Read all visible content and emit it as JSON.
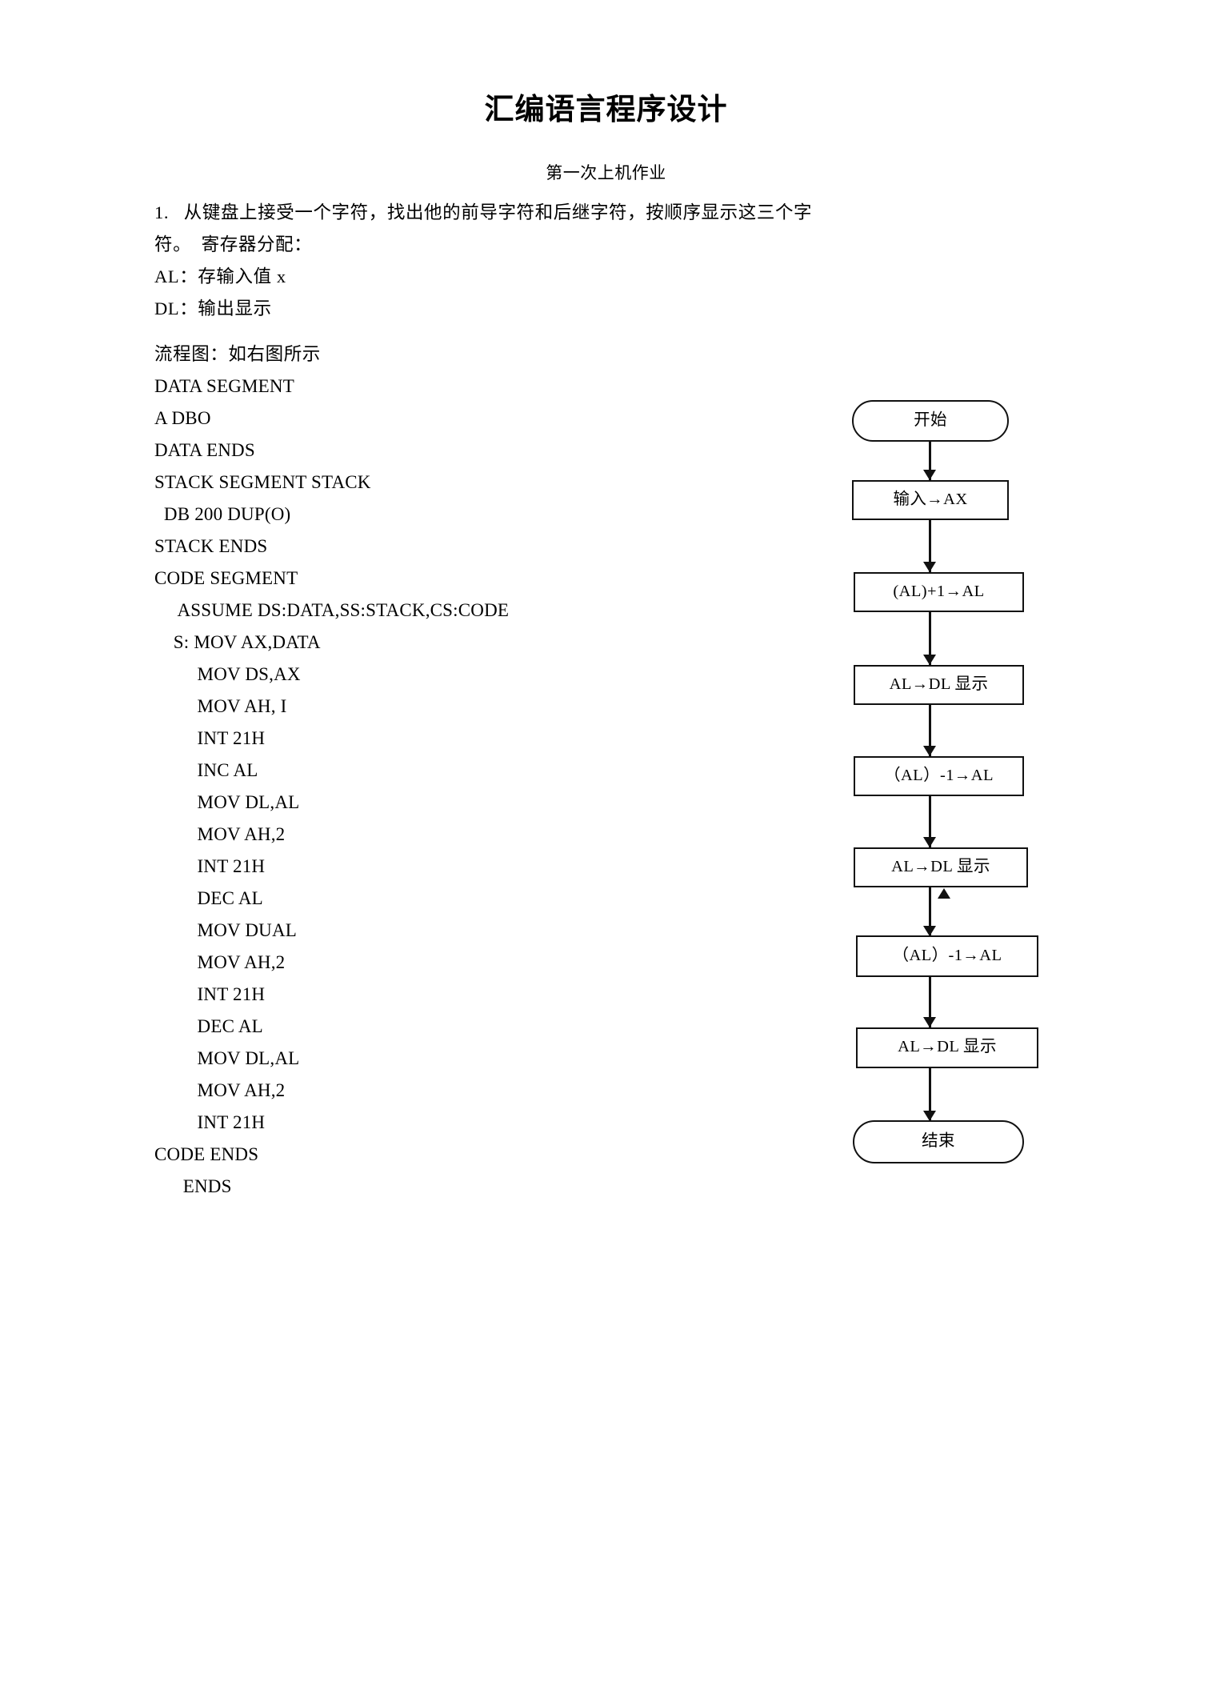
{
  "document": {
    "title": "汇编语言程序设计",
    "subtitle": "第一次上机作业"
  },
  "body": {
    "lines": [
      "1.   从键盘上接受一个字符，找出他的前导字符和后继字符，按顺序显示这三个字",
      "符。  寄存器分配：",
      "AL：存输入值 x",
      "DL：输出显示",
      "流程图：如右图所示",
      "DATA SEGMENT",
      "A DBO",
      "DATA ENDS",
      "STACK SEGMENT STACK",
      "  DB 200 DUP(O)",
      "STACK ENDS",
      "CODE SEGMENT",
      "     ASSUME DS:DATA,SS:STACK,CS:CODE",
      "    S: MOV AX,DATA",
      "         MOV DS,AX",
      "         MOV AH, I",
      "         INT 21H",
      "         INC AL",
      "         MOV DL,AL",
      "         MOV AH,2",
      "         INT 21H",
      "         DEC AL",
      "         MOV DUAL",
      "         MOV AH,2",
      "         INT 21H",
      "         DEC AL",
      "         MOV DL,AL",
      "         MOV AH,2",
      "         INT 21H",
      "CODE ENDS",
      "      ENDS"
    ]
  },
  "flowchart": {
    "nodes": [
      {
        "id": "start",
        "label": "开始",
        "shape": "terminator"
      },
      {
        "id": "input",
        "label": "输入→AX",
        "shape": "process"
      },
      {
        "id": "inc",
        "label": "(AL)+1→AL",
        "shape": "process"
      },
      {
        "id": "disp1",
        "label": "AL→DL 显示",
        "shape": "process"
      },
      {
        "id": "dec1",
        "label": "（AL）-1→AL",
        "shape": "process"
      },
      {
        "id": "disp2",
        "label": "AL→DL 显示",
        "shape": "process"
      },
      {
        "id": "dec2",
        "label": "（AL）-1→AL",
        "shape": "process"
      },
      {
        "id": "disp3",
        "label": "AL→DL 显示",
        "shape": "process"
      },
      {
        "id": "end",
        "label": "结束",
        "shape": "terminator"
      }
    ]
  }
}
